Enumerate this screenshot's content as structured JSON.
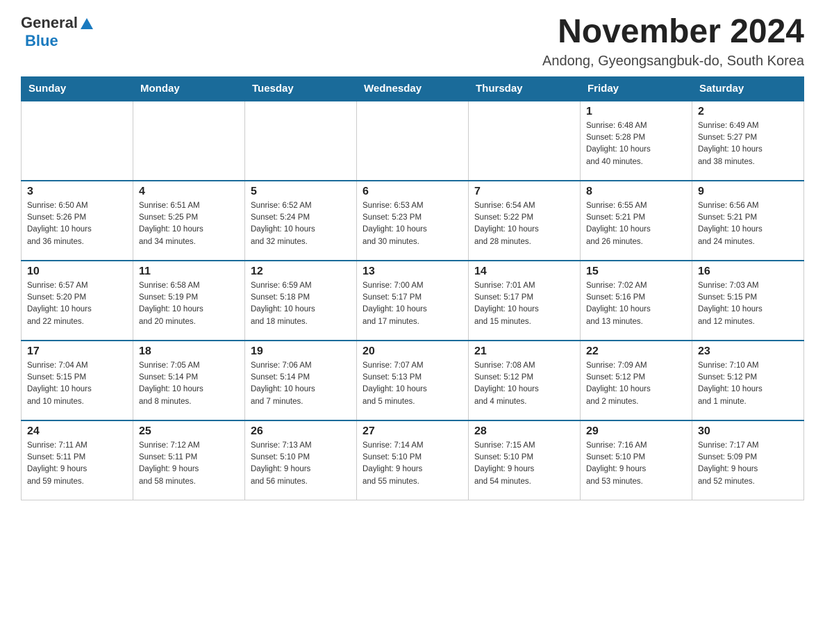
{
  "header": {
    "title": "November 2024",
    "subtitle": "Andong, Gyeongsangbuk-do, South Korea",
    "logo_general": "General",
    "logo_blue": "Blue"
  },
  "days_of_week": [
    "Sunday",
    "Monday",
    "Tuesday",
    "Wednesday",
    "Thursday",
    "Friday",
    "Saturday"
  ],
  "weeks": [
    [
      {
        "day": "",
        "info": ""
      },
      {
        "day": "",
        "info": ""
      },
      {
        "day": "",
        "info": ""
      },
      {
        "day": "",
        "info": ""
      },
      {
        "day": "",
        "info": ""
      },
      {
        "day": "1",
        "info": "Sunrise: 6:48 AM\nSunset: 5:28 PM\nDaylight: 10 hours\nand 40 minutes."
      },
      {
        "day": "2",
        "info": "Sunrise: 6:49 AM\nSunset: 5:27 PM\nDaylight: 10 hours\nand 38 minutes."
      }
    ],
    [
      {
        "day": "3",
        "info": "Sunrise: 6:50 AM\nSunset: 5:26 PM\nDaylight: 10 hours\nand 36 minutes."
      },
      {
        "day": "4",
        "info": "Sunrise: 6:51 AM\nSunset: 5:25 PM\nDaylight: 10 hours\nand 34 minutes."
      },
      {
        "day": "5",
        "info": "Sunrise: 6:52 AM\nSunset: 5:24 PM\nDaylight: 10 hours\nand 32 minutes."
      },
      {
        "day": "6",
        "info": "Sunrise: 6:53 AM\nSunset: 5:23 PM\nDaylight: 10 hours\nand 30 minutes."
      },
      {
        "day": "7",
        "info": "Sunrise: 6:54 AM\nSunset: 5:22 PM\nDaylight: 10 hours\nand 28 minutes."
      },
      {
        "day": "8",
        "info": "Sunrise: 6:55 AM\nSunset: 5:21 PM\nDaylight: 10 hours\nand 26 minutes."
      },
      {
        "day": "9",
        "info": "Sunrise: 6:56 AM\nSunset: 5:21 PM\nDaylight: 10 hours\nand 24 minutes."
      }
    ],
    [
      {
        "day": "10",
        "info": "Sunrise: 6:57 AM\nSunset: 5:20 PM\nDaylight: 10 hours\nand 22 minutes."
      },
      {
        "day": "11",
        "info": "Sunrise: 6:58 AM\nSunset: 5:19 PM\nDaylight: 10 hours\nand 20 minutes."
      },
      {
        "day": "12",
        "info": "Sunrise: 6:59 AM\nSunset: 5:18 PM\nDaylight: 10 hours\nand 18 minutes."
      },
      {
        "day": "13",
        "info": "Sunrise: 7:00 AM\nSunset: 5:17 PM\nDaylight: 10 hours\nand 17 minutes."
      },
      {
        "day": "14",
        "info": "Sunrise: 7:01 AM\nSunset: 5:17 PM\nDaylight: 10 hours\nand 15 minutes."
      },
      {
        "day": "15",
        "info": "Sunrise: 7:02 AM\nSunset: 5:16 PM\nDaylight: 10 hours\nand 13 minutes."
      },
      {
        "day": "16",
        "info": "Sunrise: 7:03 AM\nSunset: 5:15 PM\nDaylight: 10 hours\nand 12 minutes."
      }
    ],
    [
      {
        "day": "17",
        "info": "Sunrise: 7:04 AM\nSunset: 5:15 PM\nDaylight: 10 hours\nand 10 minutes."
      },
      {
        "day": "18",
        "info": "Sunrise: 7:05 AM\nSunset: 5:14 PM\nDaylight: 10 hours\nand 8 minutes."
      },
      {
        "day": "19",
        "info": "Sunrise: 7:06 AM\nSunset: 5:14 PM\nDaylight: 10 hours\nand 7 minutes."
      },
      {
        "day": "20",
        "info": "Sunrise: 7:07 AM\nSunset: 5:13 PM\nDaylight: 10 hours\nand 5 minutes."
      },
      {
        "day": "21",
        "info": "Sunrise: 7:08 AM\nSunset: 5:12 PM\nDaylight: 10 hours\nand 4 minutes."
      },
      {
        "day": "22",
        "info": "Sunrise: 7:09 AM\nSunset: 5:12 PM\nDaylight: 10 hours\nand 2 minutes."
      },
      {
        "day": "23",
        "info": "Sunrise: 7:10 AM\nSunset: 5:12 PM\nDaylight: 10 hours\nand 1 minute."
      }
    ],
    [
      {
        "day": "24",
        "info": "Sunrise: 7:11 AM\nSunset: 5:11 PM\nDaylight: 9 hours\nand 59 minutes."
      },
      {
        "day": "25",
        "info": "Sunrise: 7:12 AM\nSunset: 5:11 PM\nDaylight: 9 hours\nand 58 minutes."
      },
      {
        "day": "26",
        "info": "Sunrise: 7:13 AM\nSunset: 5:10 PM\nDaylight: 9 hours\nand 56 minutes."
      },
      {
        "day": "27",
        "info": "Sunrise: 7:14 AM\nSunset: 5:10 PM\nDaylight: 9 hours\nand 55 minutes."
      },
      {
        "day": "28",
        "info": "Sunrise: 7:15 AM\nSunset: 5:10 PM\nDaylight: 9 hours\nand 54 minutes."
      },
      {
        "day": "29",
        "info": "Sunrise: 7:16 AM\nSunset: 5:10 PM\nDaylight: 9 hours\nand 53 minutes."
      },
      {
        "day": "30",
        "info": "Sunrise: 7:17 AM\nSunset: 5:09 PM\nDaylight: 9 hours\nand 52 minutes."
      }
    ]
  ]
}
